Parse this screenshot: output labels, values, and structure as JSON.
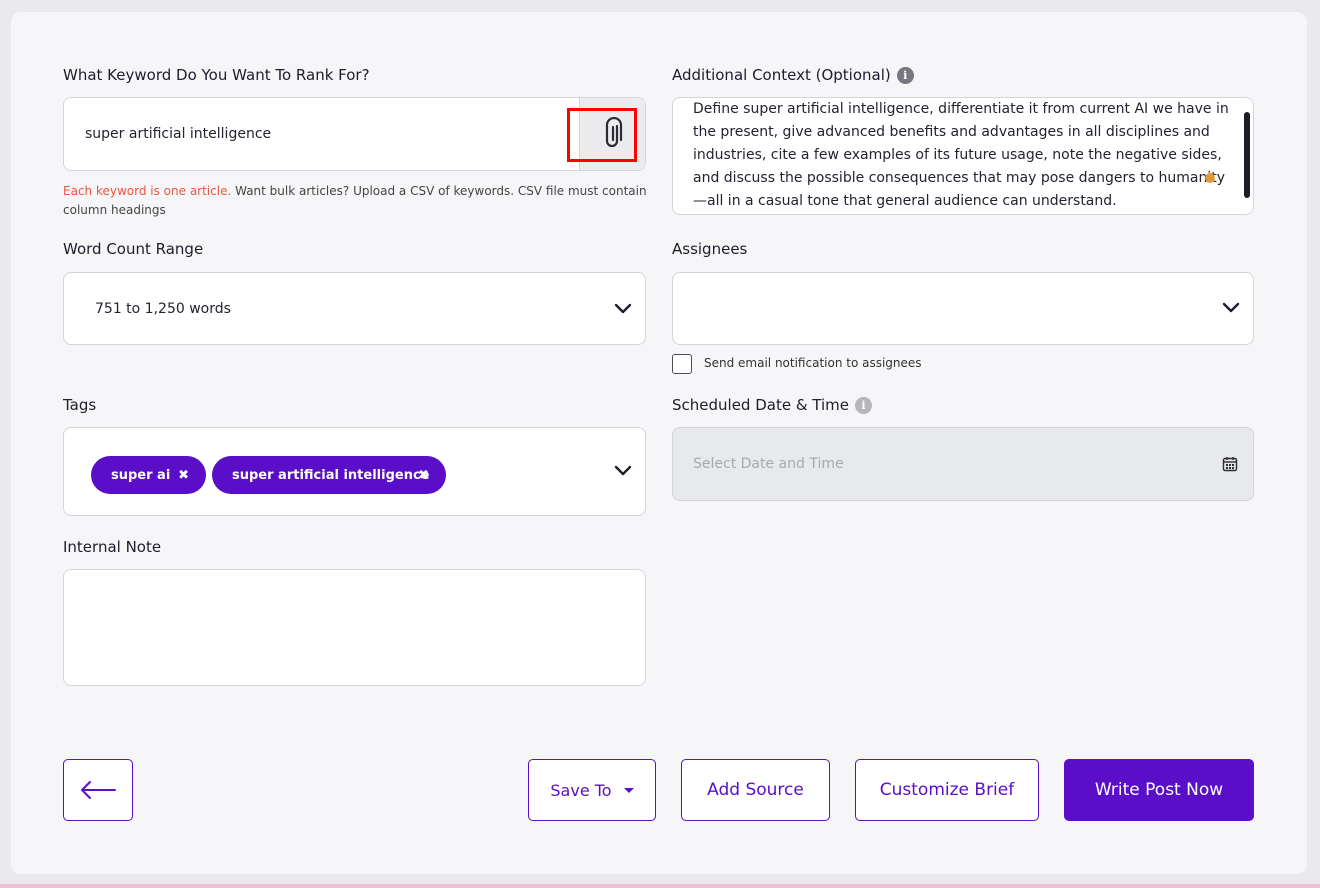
{
  "keyword": {
    "label": "What Keyword Do You Want To Rank For?",
    "value": "super artificial intelligence",
    "attach_icon": "paperclip-icon",
    "hint_red": "Each keyword is one article.",
    "hint_rest": " Want bulk articles? Upload a CSV of keywords. CSV file must contain column headings"
  },
  "context": {
    "label": "Additional Context (Optional)",
    "info_icon": "i",
    "value": "Define super artificial intelligence, differentiate it from current AI we have in the present, give advanced benefits and advantages in all disciplines and industries, cite a few examples of its future usage, note the negative sides, and discuss the possible consequences that may pose dangers to humanity—all in a casual tone that general audience can understand."
  },
  "word_count": {
    "label": "Word Count Range",
    "value": "751 to 1,250 words"
  },
  "assignees": {
    "label": "Assignees",
    "value": "",
    "notify_label": "Send email notification to assignees",
    "notify_checked": false
  },
  "tags": {
    "label": "Tags",
    "items": [
      "super ai",
      "super artificial intelligence"
    ],
    "remove_glyph": "✖"
  },
  "schedule": {
    "label": "Scheduled Date & Time",
    "info_icon": "i",
    "placeholder": "Select Date and Time"
  },
  "note": {
    "label": "Internal Note",
    "value": ""
  },
  "actions": {
    "back_icon": "arrow-left-icon",
    "save_to": "Save To",
    "add_source": "Add Source",
    "customize_brief": "Customize Brief",
    "write_post": "Write Post Now"
  },
  "colors": {
    "accent": "#5a0ec8",
    "hint_red": "#e8573f",
    "highlight": "#ff0000"
  }
}
